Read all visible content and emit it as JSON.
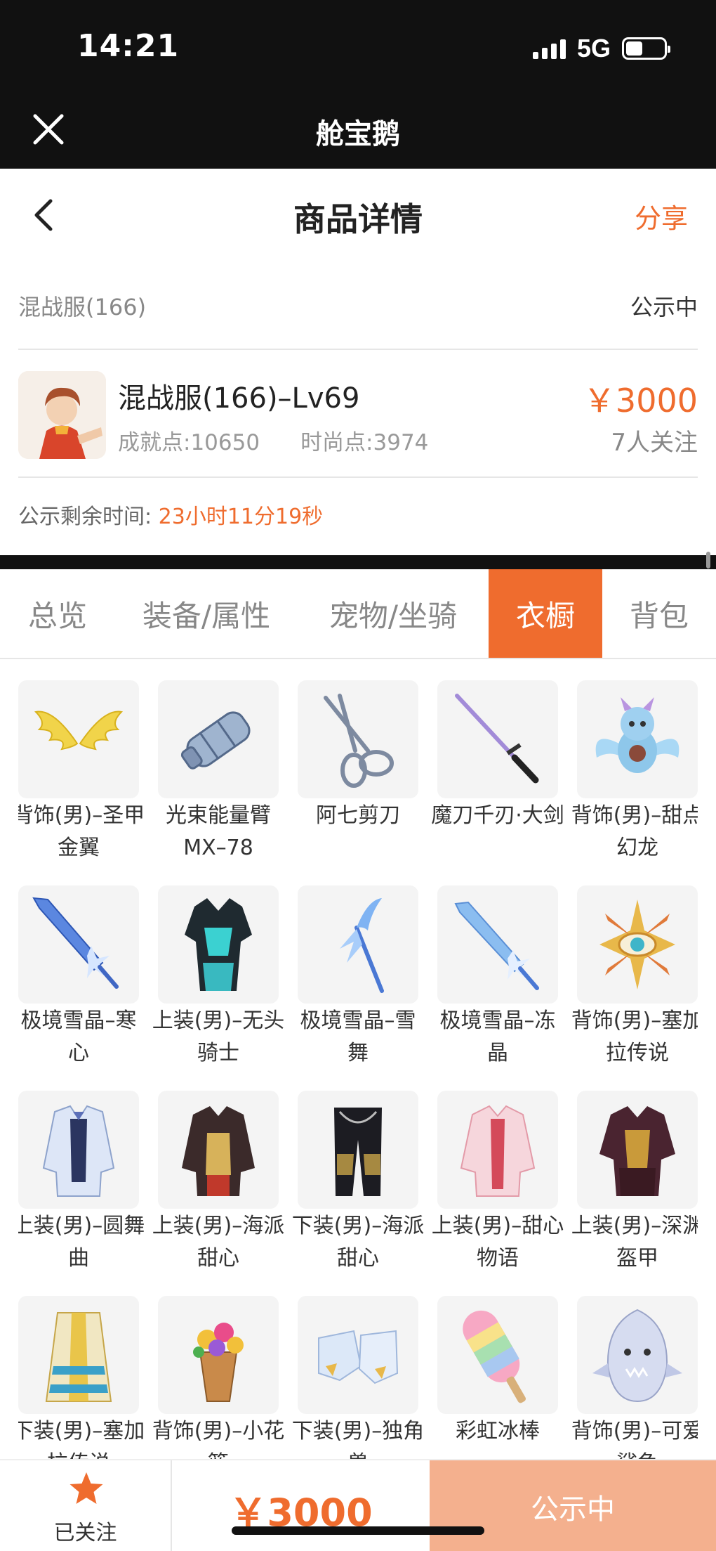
{
  "status_bar": {
    "time": "14:21",
    "network": "5G"
  },
  "app": {
    "title": "舱宝鹅"
  },
  "header": {
    "title": "商品详情",
    "share_label": "分享"
  },
  "server": {
    "name": "混战服(166)",
    "status": "公示中"
  },
  "product": {
    "title": "混战服(166)–Lv69",
    "achievement": "成就点:10650",
    "fashion": "时尚点:3974",
    "price": "￥3000",
    "followers": "7人关注"
  },
  "countdown": {
    "label": "公示剩余时间:",
    "value": "23小时11分19秒"
  },
  "tabs": [
    {
      "label": "总览",
      "active": false
    },
    {
      "label": "装备/属性",
      "active": false
    },
    {
      "label": "宠物/坐骑",
      "active": false
    },
    {
      "label": "衣橱",
      "active": true
    },
    {
      "label": "背包",
      "active": false
    }
  ],
  "items": [
    {
      "name": "背饰(男)–圣甲金翼",
      "icon": "golden-wings-icon"
    },
    {
      "name": "光束能量臂MX–78",
      "icon": "energy-arm-icon"
    },
    {
      "name": "阿七剪刀",
      "icon": "scissors-icon"
    },
    {
      "name": "魔刀千刃·大剑",
      "icon": "katana-icon"
    },
    {
      "name": "背饰(男)–甜点幻龙",
      "icon": "dragon-icon"
    },
    {
      "name": "极境雪晶–寒心",
      "icon": "ice-sword-icon"
    },
    {
      "name": "上装(男)–无头骑士",
      "icon": "armor-icon"
    },
    {
      "name": "极境雪晶–雪舞",
      "icon": "ice-scythe-icon"
    },
    {
      "name": "极境雪晶–冻晶",
      "icon": "ice-sword-icon"
    },
    {
      "name": "背饰(男)–塞加拉传说",
      "icon": "eye-emblem-icon"
    },
    {
      "name": "上装(男)–圆舞曲",
      "icon": "jacket-icon"
    },
    {
      "name": "上装(男)–海派甜心",
      "icon": "jacket-icon"
    },
    {
      "name": "下装(男)–海派甜心",
      "icon": "pants-icon"
    },
    {
      "name": "上装(男)–甜心物语",
      "icon": "jacket-icon"
    },
    {
      "name": "上装(男)–深渊盔甲",
      "icon": "armor-icon"
    },
    {
      "name": "下装(男)–塞加拉传说",
      "icon": "robe-icon"
    },
    {
      "name": "背饰(男)–小花篮",
      "icon": "flower-basket-icon"
    },
    {
      "name": "下装(男)–独角兽",
      "icon": "boots-icon"
    },
    {
      "name": "彩虹冰棒",
      "icon": "popsicle-icon"
    },
    {
      "name": "背饰(男)–可爱鲨鱼",
      "icon": "shark-icon"
    }
  ],
  "bottom_bar": {
    "follow_label": "已关注",
    "price": "￥3000",
    "status_label": "公示中"
  },
  "colors": {
    "accent": "#ef6c2e",
    "dark": "#111111",
    "disabled_accent": "#f4b08e"
  }
}
